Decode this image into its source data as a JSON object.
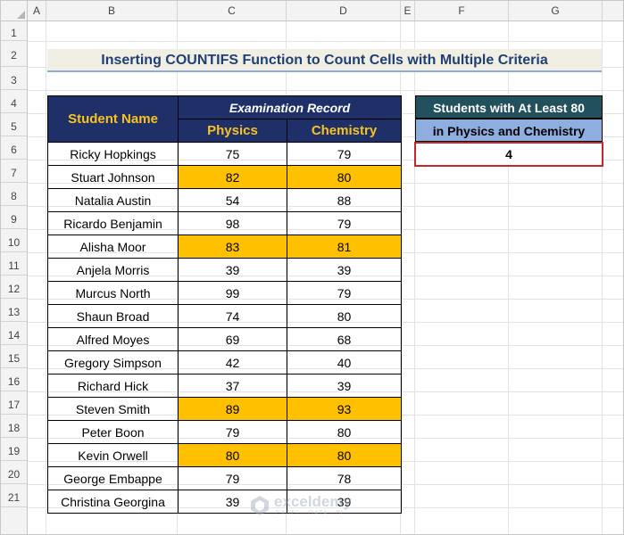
{
  "columns": [
    "A",
    "B",
    "C",
    "D",
    "E",
    "F",
    "G"
  ],
  "rows": [
    "1",
    "2",
    "3",
    "4",
    "5",
    "6",
    "7",
    "8",
    "9",
    "10",
    "11",
    "12",
    "13",
    "14",
    "15",
    "16",
    "17",
    "18",
    "19",
    "20",
    "21"
  ],
  "title": "Inserting COUNTIFS Function to Count Cells with Multiple Criteria",
  "table": {
    "header_name": "Student Name",
    "header_group": "Examination Record",
    "header_physics": "Physics",
    "header_chemistry": "Chemistry",
    "records": [
      {
        "name": "Ricky Hopkings",
        "physics": "75",
        "chemistry": "79",
        "highlight": false
      },
      {
        "name": "Stuart Johnson",
        "physics": "82",
        "chemistry": "80",
        "highlight": true
      },
      {
        "name": "Natalia Austin",
        "physics": "54",
        "chemistry": "88",
        "highlight": false
      },
      {
        "name": "Ricardo Benjamin",
        "physics": "98",
        "chemistry": "79",
        "highlight": false
      },
      {
        "name": "Alisha Moor",
        "physics": "83",
        "chemistry": "81",
        "highlight": true
      },
      {
        "name": "Anjela Morris",
        "physics": "39",
        "chemistry": "39",
        "highlight": false
      },
      {
        "name": "Murcus North",
        "physics": "99",
        "chemistry": "79",
        "highlight": false
      },
      {
        "name": "Shaun Broad",
        "physics": "74",
        "chemistry": "80",
        "highlight": false
      },
      {
        "name": "Alfred Moyes",
        "physics": "69",
        "chemistry": "68",
        "highlight": false
      },
      {
        "name": "Gregory Simpson",
        "physics": "42",
        "chemistry": "40",
        "highlight": false
      },
      {
        "name": "Richard Hick",
        "physics": "37",
        "chemistry": "39",
        "highlight": false
      },
      {
        "name": "Steven Smith",
        "physics": "89",
        "chemistry": "93",
        "highlight": true
      },
      {
        "name": "Peter Boon",
        "physics": "79",
        "chemistry": "80",
        "highlight": false
      },
      {
        "name": "Kevin Orwell",
        "physics": "80",
        "chemistry": "80",
        "highlight": true
      },
      {
        "name": "George Embappe",
        "physics": "79",
        "chemistry": "78",
        "highlight": false
      },
      {
        "name": "Christina Georgina",
        "physics": "39",
        "chemistry": "39",
        "highlight": false
      }
    ]
  },
  "summary": {
    "label_line1": "Students with At Least 80",
    "label_line2": "in Physics and Chemistry",
    "value": "4"
  },
  "watermark": {
    "brand": "exceldemy",
    "tagline": "EXCEL · DATA · BI"
  },
  "colors": {
    "header_bg": "#1f2f68",
    "header_text": "#f8c321",
    "highlight": "#ffc000",
    "summary_top": "#23505d",
    "summary_mid": "#8eaee0",
    "result_border": "#c1272d"
  }
}
